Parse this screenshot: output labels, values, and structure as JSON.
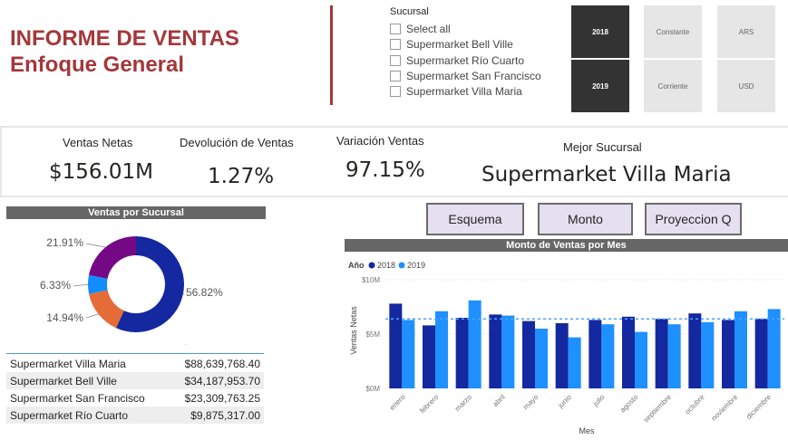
{
  "header": {
    "title_line1": "INFORME DE VENTAS",
    "title_line2": "Enfoque General"
  },
  "slicer": {
    "title": "Sucursal",
    "items": [
      "Select all",
      "Supermarket Bell Ville",
      "Supermarket Río Cuarto",
      "Supermarket San Francisco",
      "Supermarket Villa Maria"
    ]
  },
  "tiles": {
    "year_2018": "2018",
    "year_2019": "2019",
    "constante": "Constante",
    "corriente": "Corriente",
    "ars": "ARS",
    "usd": "USD"
  },
  "kpis": {
    "ventas_netas_label": "Ventas Netas",
    "ventas_netas_value": "$156.01M",
    "devolucion_label": "Devolución de Ventas",
    "devolucion_value": "1.27%",
    "variacion_label": "Variación Ventas",
    "variacion_value": "97.15%",
    "mejor_label": "Mejor Sucursal",
    "mejor_value": "Supermarket Villa Maria"
  },
  "buttons": {
    "esquema": "Esquema",
    "monto": "Monto",
    "proyeccion": "Proyeccion Q"
  },
  "colors": {
    "accent": "#a4373a",
    "series_2018": "#1428a0",
    "series_2019": "#1e90ff",
    "donut_purple": "#750985",
    "donut_blue": "#118dff",
    "donut_orange": "#e66c37"
  },
  "sucursal_table": {
    "rows": [
      {
        "name": "Supermarket Villa Maria",
        "value": "$88,639,768.40"
      },
      {
        "name": "Supermarket Bell Ville",
        "value": "$34,187,953.70"
      },
      {
        "name": "Supermarket San Francisco",
        "value": "$23,309,763.25"
      },
      {
        "name": "Supermarket Río Cuarto",
        "value": "$9,875,317.00"
      }
    ]
  },
  "chart_data": [
    {
      "type": "pie",
      "title": "Ventas por Sucursal",
      "labels": [
        "56.82%",
        "14.94%",
        "6.33%",
        "21.91%"
      ],
      "values": [
        56.82,
        14.94,
        6.33,
        21.91
      ],
      "colors": [
        "#1428a0",
        "#e66c37",
        "#118dff",
        "#750985"
      ]
    },
    {
      "type": "bar",
      "title": "Monto de Ventas por Mes",
      "xlabel": "Mes",
      "ylabel": "Ventas Netas",
      "legend_title": "Año",
      "categories": [
        "enero",
        "febrero",
        "marzo",
        "abril",
        "mayo",
        "junio",
        "julio",
        "agosto",
        "septiembre",
        "octubre",
        "noviembre",
        "diciembre"
      ],
      "series": [
        {
          "name": "2018",
          "values": [
            7.8,
            5.8,
            6.5,
            6.8,
            6.2,
            6.0,
            6.3,
            6.6,
            6.4,
            6.9,
            6.3,
            6.4
          ],
          "color": "#1428a0"
        },
        {
          "name": "2019",
          "values": [
            6.3,
            7.1,
            8.1,
            6.7,
            5.5,
            4.7,
            5.9,
            5.2,
            5.9,
            6.1,
            7.1,
            7.3
          ],
          "color": "#1e90ff"
        }
      ],
      "average_line": 6.4,
      "yticks": [
        "$0M",
        "$5M",
        "$10M"
      ],
      "ylim": [
        0,
        10
      ]
    }
  ]
}
